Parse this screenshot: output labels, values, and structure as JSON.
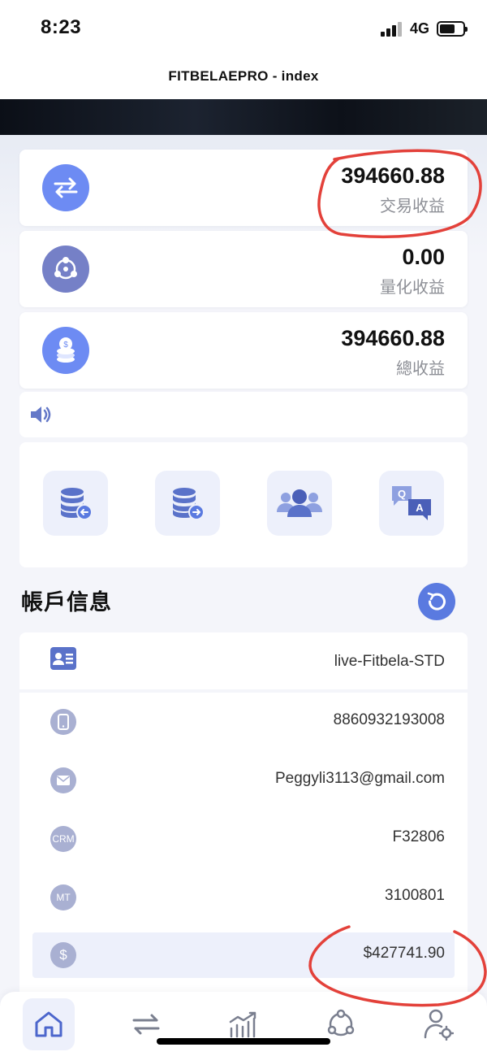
{
  "status_bar": {
    "time": "8:23",
    "network": "4G"
  },
  "header": {
    "title": "FITBELAEPRO - index"
  },
  "stats": [
    {
      "value": "394660.88",
      "label": "交易收益",
      "icon": "swap-arrows-icon",
      "color": "#6d8bf3"
    },
    {
      "value": "0.00",
      "label": "量化收益",
      "icon": "network-nodes-icon",
      "color": "#7580c7"
    },
    {
      "value": "394660.88",
      "label": "總收益",
      "icon": "coin-stack-icon",
      "color": "#6d8bf3"
    }
  ],
  "quick_actions": [
    "deposit-icon",
    "withdraw-icon",
    "team-icon",
    "qa-icon"
  ],
  "account_section": {
    "title": "帳戶信息",
    "account_type": "live-Fitbela-STD",
    "rows": [
      {
        "icon": "phone-icon",
        "value": "8860932193008"
      },
      {
        "icon": "mail-icon",
        "value": "Peggyli3113@gmail.com"
      },
      {
        "icon_text": "CRM",
        "value": "F32806"
      },
      {
        "icon_text": "MT",
        "value": "3100801"
      },
      {
        "icon_text": "$",
        "value": "$427741.90"
      }
    ]
  },
  "tabbar": {
    "items": [
      "home-icon",
      "trade-icon",
      "market-chart-icon",
      "quant-icon",
      "user-settings-icon"
    ],
    "active": "home-icon"
  },
  "colors": {
    "accent": "#5a7ae0",
    "annotation": "#e3413a",
    "background": "#f4f5fa"
  }
}
